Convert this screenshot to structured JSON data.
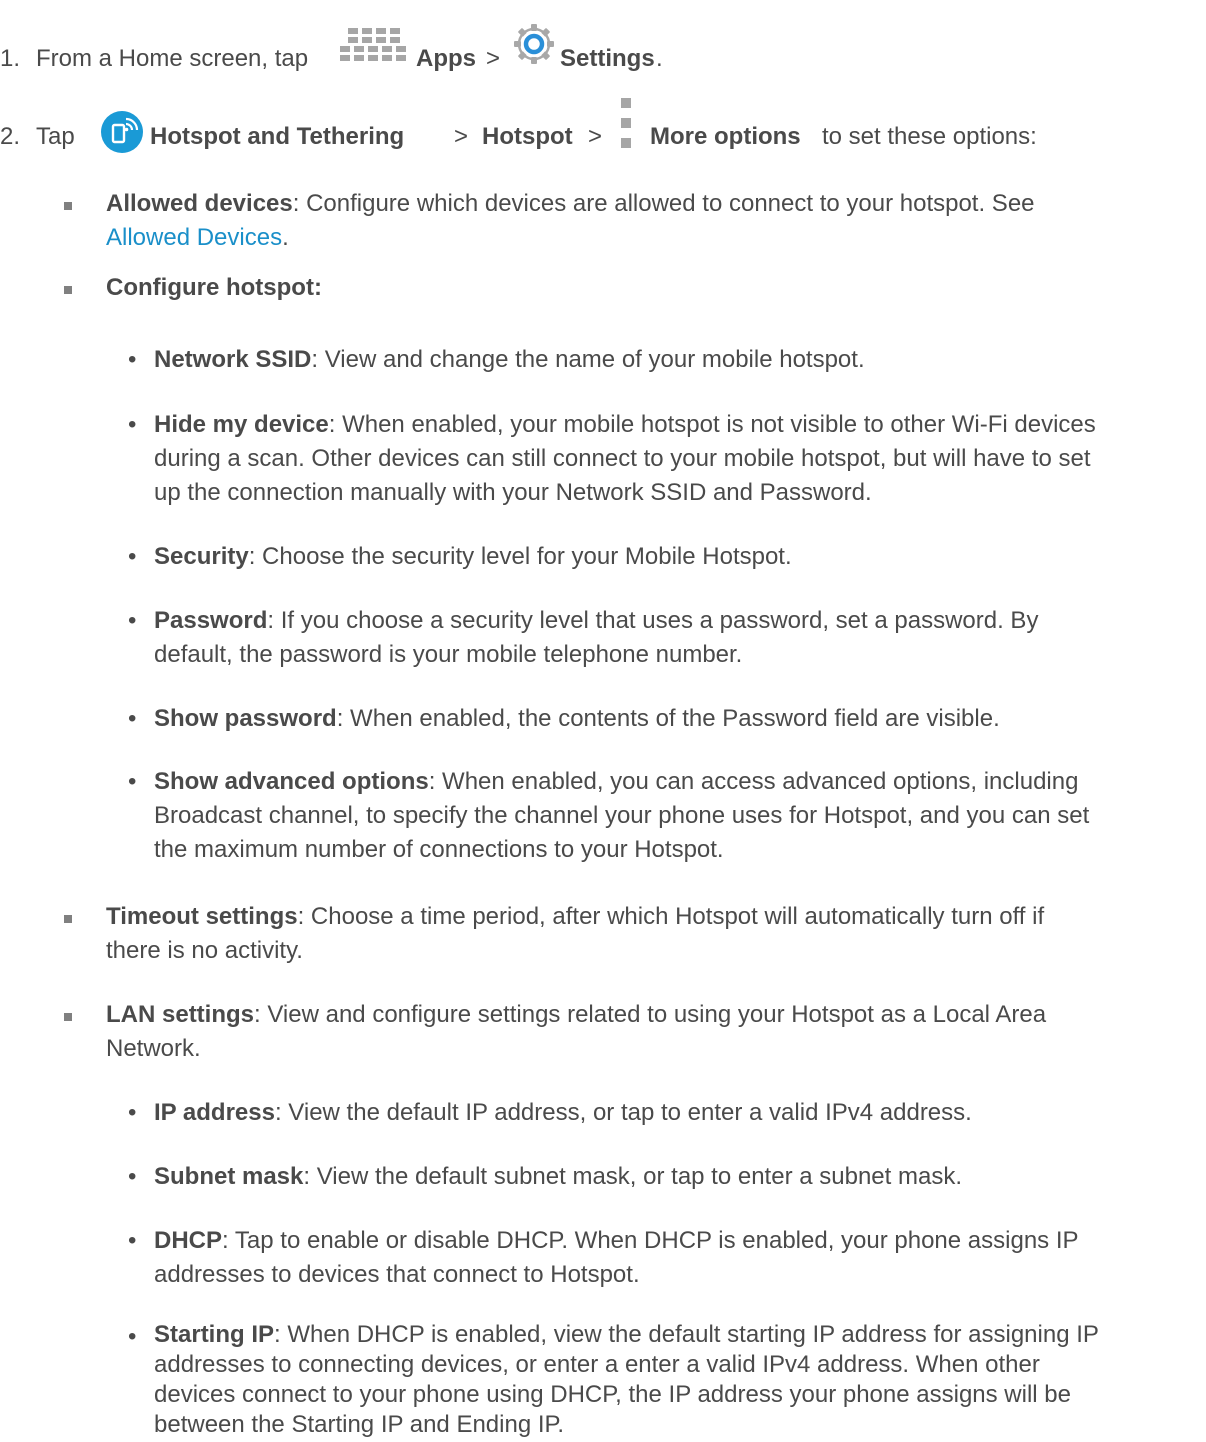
{
  "step1": {
    "number": "1.",
    "prefix": "From a Home screen, tap",
    "apps_label": "Apps",
    "sep": ">",
    "settings_label": "Settings",
    "end": ".",
    "apps_icon": "apps-grid-icon",
    "settings_icon": "settings-gear-icon"
  },
  "step2": {
    "number": "2.",
    "tap": "Tap",
    "hotspot_tethering": "Hotspot and Tethering",
    "sep1": ">",
    "hotspot": "Hotspot",
    "sep2": ">",
    "more_options": "More options",
    "suffix": "to set these options:",
    "hotspot_icon": "hotspot-tethering-icon",
    "more_icon": "more-options-icon"
  },
  "items": {
    "allowed": {
      "title": "Allowed devices",
      "text": ": Configure which devices are allowed to connect to your hotspot. See",
      "link": "Allowed Devices",
      "end": "."
    },
    "configure": {
      "title": "Configure hotspot:"
    },
    "ssid": {
      "title": "Network SSID",
      "text": ": View and change the name of your mobile hotspot."
    },
    "hide": {
      "title": "Hide my device",
      "text1": ": When enabled, your mobile hotspot is not visible to other Wi-Fi devices",
      "text2": "during a scan. Other devices can still connect to your mobile hotspot, but will have to set",
      "text3": "up the connection manually with your Network SSID and Password."
    },
    "security": {
      "title": "Security",
      "text": ": Choose the security level for your Mobile Hotspot."
    },
    "password": {
      "title": "Password",
      "text1": ": If you choose a security level that uses a password, set a password. By",
      "text2": "default, the password is your mobile telephone number."
    },
    "showpw": {
      "title": "Show password",
      "text": ": When enabled, the contents of the Password field are visible."
    },
    "advanced": {
      "title": "Show advanced options",
      "text1": ": When enabled, you can access advanced options, including",
      "text2": "Broadcast channel, to specify the channel your phone uses for Hotspot, and you can set",
      "text3": "the maximum number of connections to your Hotspot."
    },
    "timeout": {
      "title": "Timeout settings",
      "text1": ": Choose a time period, after which Hotspot will automatically turn off if",
      "text2": "there is no activity."
    },
    "lan": {
      "title": "LAN settings",
      "text1": ": View and configure settings related to using your Hotspot as a Local Area",
      "text2": "Network."
    },
    "ip": {
      "title": "IP address",
      "text": ": View the default IP address, or tap to enter a valid IPv4 address."
    },
    "subnet": {
      "title": "Subnet mask",
      "text": ": View the default subnet mask, or tap to enter a subnet mask."
    },
    "dhcp": {
      "title": "DHCP",
      "text1": ": Tap to enable or disable DHCP. When DHCP is enabled, your phone assigns IP",
      "text2": "addresses to devices that connect to Hotspot."
    },
    "startip": {
      "title": "Starting IP",
      "text1": ": When DHCP is enabled, view the default starting IP address for assigning IP",
      "text2": "addresses to connecting devices, or enter a enter a valid IPv4 address. When other",
      "text3": "devices connect to your phone using DHCP, the IP address your phone assigns will be",
      "text4": "between the Starting IP and Ending IP."
    }
  },
  "bullet": "•"
}
